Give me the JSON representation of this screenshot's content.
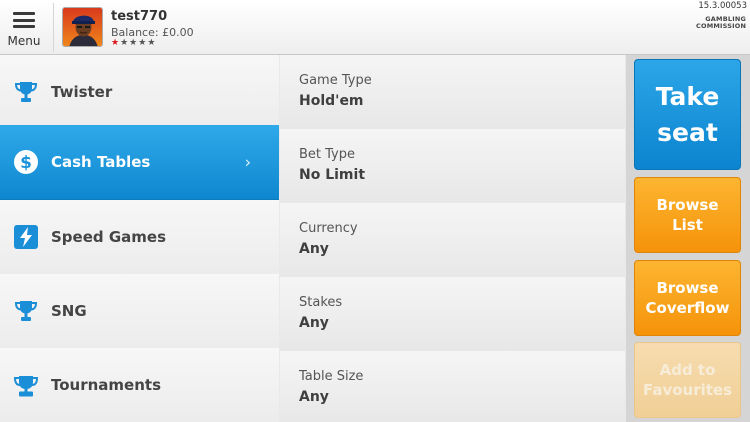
{
  "header": {
    "menu_label": "Menu",
    "username": "test770",
    "balance": "Balance: £0.00",
    "rating": 1,
    "rating_max": 5,
    "version": "15.3.00053",
    "gambling_line1": "GAMBLING",
    "gambling_line2": "COMMISSION"
  },
  "nav": {
    "items": [
      {
        "label": "Twister",
        "icon": "trophy-icon"
      },
      {
        "label": "Cash Tables",
        "icon": "dollar-icon",
        "active": true
      },
      {
        "label": "Speed Games",
        "icon": "lightning-icon"
      },
      {
        "label": "SNG",
        "icon": "trophy-icon"
      },
      {
        "label": "Tournaments",
        "icon": "tournament-trophy-icon"
      }
    ],
    "chevron": "›"
  },
  "filters": [
    {
      "label": "Game Type",
      "value": "Hold'em"
    },
    {
      "label": "Bet Type",
      "value": "No Limit"
    },
    {
      "label": "Currency",
      "value": "Any"
    },
    {
      "label": "Stakes",
      "value": "Any"
    },
    {
      "label": "Table Size",
      "value": "Any"
    }
  ],
  "actions": {
    "take_seat_1": "Take",
    "take_seat_2": "seat",
    "browse_list_1": "Browse",
    "browse_list_2": "List",
    "browse_coverflow_1": "Browse",
    "browse_coverflow_2": "Coverflow",
    "favourites_1": "Add to",
    "favourites_2": "Favourites"
  },
  "colors": {
    "accent_blue": "#1a97dd",
    "accent_orange": "#f8a21c",
    "disabled_orange": "#f3d4a0",
    "rating_star": "#d7191c"
  }
}
